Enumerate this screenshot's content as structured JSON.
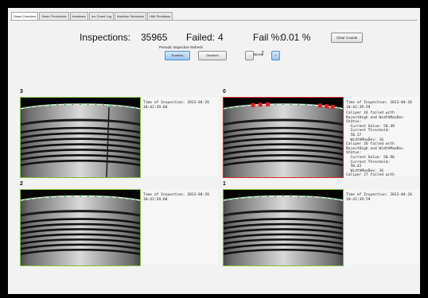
{
  "tabs": [
    "Seam Overview",
    "Seam Thresholds",
    "Hardware",
    "Inv. Event Log",
    "Machine Shutdown",
    "HMI Shutdown"
  ],
  "stats": {
    "inspections_label": "Inspections:",
    "inspections_value": "35965",
    "failed_label": "Failed:",
    "failed_value": "4",
    "fail_pct_label": "Fail %:",
    "fail_pct_value": "0.01 %"
  },
  "clear_counts_label": "Clear Counts",
  "refresh": {
    "title": "Periodic Inspection Refresh",
    "enabled_label": "Enabled",
    "disabled_label": "Disabled",
    "interval_label": "Interval",
    "interval_value": "7",
    "minus_label": "-",
    "plus_label": "+"
  },
  "panels": [
    {
      "number": "3",
      "status": "passed",
      "time_label": "Time of Inspection: 2013-04-26",
      "time_value": "10:42:39.60",
      "details": ""
    },
    {
      "number": "0",
      "status": "failed",
      "time_label": "Time of Inspection: 2013-04-26",
      "time_value": "10:42:39.59",
      "details": "Caliper 16 failed with\nRejectHigh and WidthMaxDev\nStatus:\n  Current Value: 50.49\n  Current Threshold:\n  50.37\n  WidthMaxDev: 16\nCaliper 26 failed with\nRejectHigh and WidthMaxDev\nStatus:\n  Current Value: 50.96\n  Current Threshold:\n  50.42\n  WidthMaxDev: 16\nCaliper 27 failed with"
    },
    {
      "number": "2",
      "status": "passed",
      "time_label": "Time of Inspection: 2013-04-26",
      "time_value": "10:42:39.60",
      "details": ""
    },
    {
      "number": "1",
      "status": "passed",
      "time_label": "Time of Inspection: 2013-04-26",
      "time_value": "10:42:39.59",
      "details": ""
    }
  ],
  "colors": {
    "pass_border": "#7fbf3f",
    "fail_border": "#e02a2a",
    "caliper_marker": "#3fbf5f",
    "defect_marker": "#e02020"
  }
}
